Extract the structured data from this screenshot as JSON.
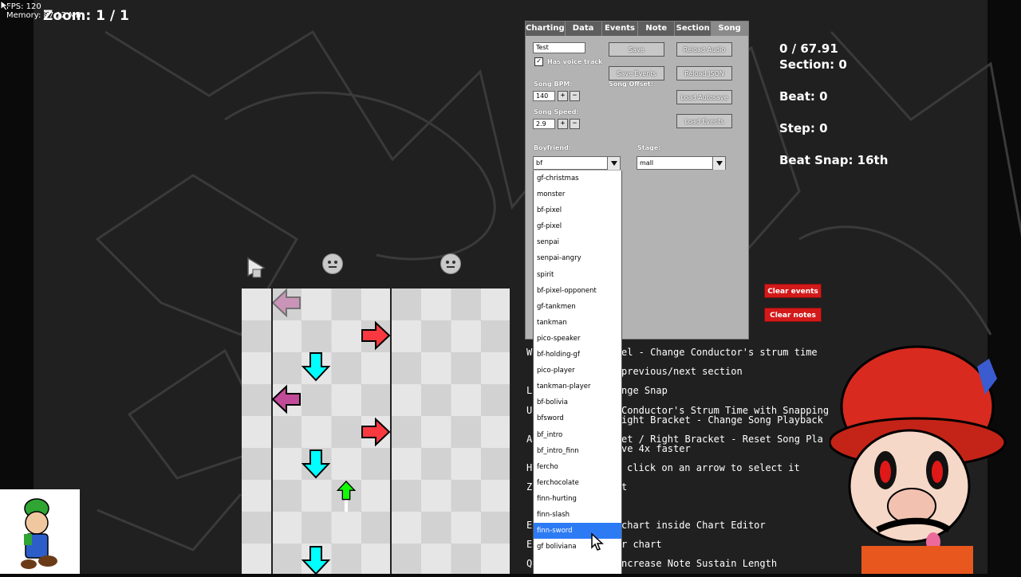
{
  "hud": {
    "fps": "FPS: 120",
    "memory": "Memory: 87.12 MB",
    "zoom": "Zoom: 1 / 1"
  },
  "panel": {
    "tabs": [
      "Charting",
      "Data",
      "Events",
      "Note",
      "Section",
      "Song"
    ],
    "active_tab": "Song",
    "song_name": "Test",
    "has_voice_track_label": "Has voice track",
    "has_voice_track_checked": true,
    "save_label": "Save",
    "reload_audio_label": "Reload Audio",
    "save_events_label": "Save Events",
    "reload_json_label": "Reload JSON",
    "load_autosave_label": "Load Autosave",
    "load_events_label": "Load Events",
    "song_offset_label": "Song Offset:",
    "song_bpm_label": "Song BPM:",
    "song_bpm_value": "140",
    "song_speed_label": "Song Speed:",
    "song_speed_value": "2.9",
    "plus": "+",
    "minus": "−",
    "boyfriend_label": "Boyfriend:",
    "boyfriend_value": "bf",
    "stage_label": "Stage:",
    "stage_value": "mall"
  },
  "dropdown_options": [
    "gf-christmas",
    "monster",
    "bf-pixel",
    "gf-pixel",
    "senpai",
    "senpai-angry",
    "spirit",
    "bf-pixel-opponent",
    "gf-tankmen",
    "tankman",
    "pico-speaker",
    "bf-holding-gf",
    "pico-player",
    "tankman-player",
    "bf-bolivia",
    "bfsword",
    "bf_intro",
    "bf_intro_finn",
    "fercho",
    "ferchocolate",
    "finn-hurting",
    "finn-slash",
    "finn-sword",
    "gf boliviana"
  ],
  "dropdown_selected": "finn-sword",
  "info": {
    "time": "0 / 67.91",
    "section": "Section: 0",
    "beat": "Beat: 0",
    "step": "Step: 0",
    "beat_snap": "Beat Snap: 16th"
  },
  "clear_events_label": "Clear events",
  "clear_notes_label": "Clear notes",
  "help_lines": [
    {
      "prefix": "W",
      "text": "el - Change Conductor's strum time"
    },
    {
      "prefix": "",
      "text": "previous/next section"
    },
    {
      "prefix": "L",
      "text": "nge Snap"
    },
    {
      "prefix": "U",
      "text": "Conductor's Strum Time with Snapping"
    },
    {
      "prefix": "",
      "text": "ight Bracket - Change Song Playback"
    },
    {
      "prefix": "A",
      "text": "et / Right Bracket - Reset Song Pla"
    },
    {
      "prefix": "",
      "text": "ve 4x faster"
    },
    {
      "prefix": "H",
      "text": "click on an arrow to select it"
    },
    {
      "prefix": "Z",
      "text": "t"
    },
    {
      "prefix": "E",
      "text": "chart inside Chart Editor"
    },
    {
      "prefix": "E",
      "text": "r chart"
    },
    {
      "prefix": "Q",
      "text": "ncrease Note Sustain Length"
    }
  ],
  "colors": {
    "left": "#c24b99",
    "down": "#00ffff",
    "up": "#12fa05",
    "right": "#f9393f",
    "selected": "#2d7bf4",
    "clear_btn": "#d31919"
  },
  "icons": {
    "strum_event": "play-cursor-icon",
    "opponent_head": "opponent-health-icon",
    "player_head": "player-health-icon"
  }
}
